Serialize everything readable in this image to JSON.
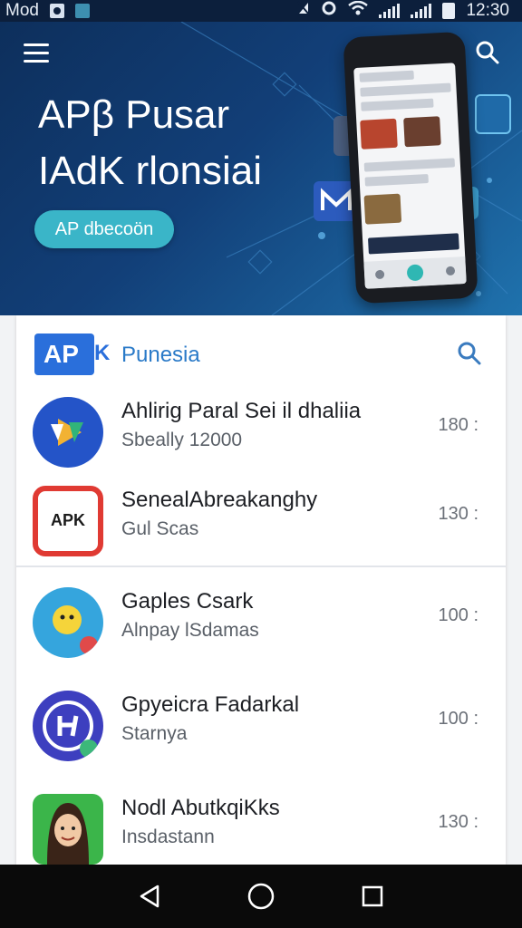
{
  "status_bar": {
    "left_text": "Mod",
    "time": "12:30"
  },
  "hero": {
    "title_line1": "APβ Pusar",
    "title_line2": "IAdK rlonsiai",
    "button_label": "AP dbecoön"
  },
  "card": {
    "logo_text": "AP",
    "logo_suffix": "K",
    "brand_name": "Punesia"
  },
  "apps": [
    {
      "title": "Ahlirig Paral Sei il dhaliia",
      "subtitle": "Sbeally 12000",
      "count": "180 :"
    },
    {
      "title": "SenealAbreakanghy",
      "subtitle": "Gul Scas",
      "count": "130 :",
      "icon_text": "APK"
    },
    {
      "title": "Gaples Csark",
      "subtitle": "Alnpay lSdamas",
      "count": "100 :"
    },
    {
      "title": "Gpyeicra Fadarkal",
      "subtitle": "Starnya",
      "count": "100 :"
    },
    {
      "title": "Nodl AbutkqiKks",
      "subtitle": "Insdastann",
      "count": "130 :"
    }
  ],
  "colors": {
    "hero_dark": "#0d2f5c",
    "accent": "#3ab5c8",
    "brand_blue": "#2a6fdb"
  },
  "icons": [
    "menu-icon",
    "search-icon",
    "back-icon",
    "home-icon",
    "recents-icon"
  ]
}
